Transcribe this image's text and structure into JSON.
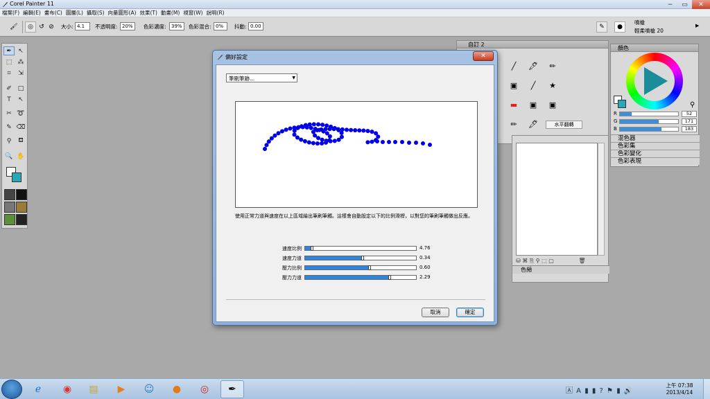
{
  "app": {
    "title": "Corel Painter 11",
    "window_controls": [
      "−",
      "▭",
      "✕"
    ]
  },
  "menu": [
    "檔案(F)",
    "編輯(E)",
    "畫布(C)",
    "圖層(L)",
    "攝取(S)",
    "向量圖形(A)",
    "效果(T)",
    "動畫(M)",
    "視窗(W)",
    "說明(R)"
  ],
  "propbar": {
    "size_label": "大小:",
    "size_value": "4.1",
    "opacity_label": "不透明度:",
    "opacity_value": "20%",
    "resat_label": "色彩濃度:",
    "resat_value": "39%",
    "bleed_label": "色彩混合:",
    "bleed_value": "0%",
    "jitter_label": "抖動:",
    "jitter_value": "0.00",
    "brush_category": "噴槍",
    "brush_variant": "輕柔噴槍 20"
  },
  "panels": {
    "custom_title": "自訂 2",
    "flip_button": "水平翻轉",
    "library_footer": "色頻",
    "color_title": "顏色",
    "rgb": [
      {
        "label": "R",
        "value": "52",
        "fraction": 0.2
      },
      {
        "label": "G",
        "value": "171",
        "fraction": 0.67
      },
      {
        "label": "B",
        "value": "183",
        "fraction": 0.72
      }
    ],
    "sub_panels": [
      "混色器",
      "色彩集",
      "色彩變化",
      "色彩表現"
    ]
  },
  "dialog": {
    "title": "偏好設定",
    "close": "✕",
    "dropdown_value": "筆刷筆跡...",
    "description": "使用正常力道與速度在以上區域繪出筆刷筆觸。這樣會自動設定以下的比例滑桿，以對您的筆刷筆觸做出反應。",
    "sliders": [
      {
        "label": "速度比例",
        "value": "4.76",
        "fraction": 0.06
      },
      {
        "label": "速度力道",
        "value": "0.34",
        "fraction": 0.52
      },
      {
        "label": "壓力比例",
        "value": "0.60",
        "fraction": 0.58
      },
      {
        "label": "壓力力道",
        "value": "2.29",
        "fraction": 0.76
      }
    ],
    "cancel": "取消",
    "ok": "確定"
  },
  "taskbar": {
    "time": "上午 07:38",
    "date": "2013/4/14",
    "tray": "🄰 A ▮ ▮ ? ⚑ ▮ 🔊"
  },
  "colors": {
    "accent_teal": "#29a9b8",
    "stroke_blue": "#0000e6",
    "slider_blue": "#2d85de"
  }
}
